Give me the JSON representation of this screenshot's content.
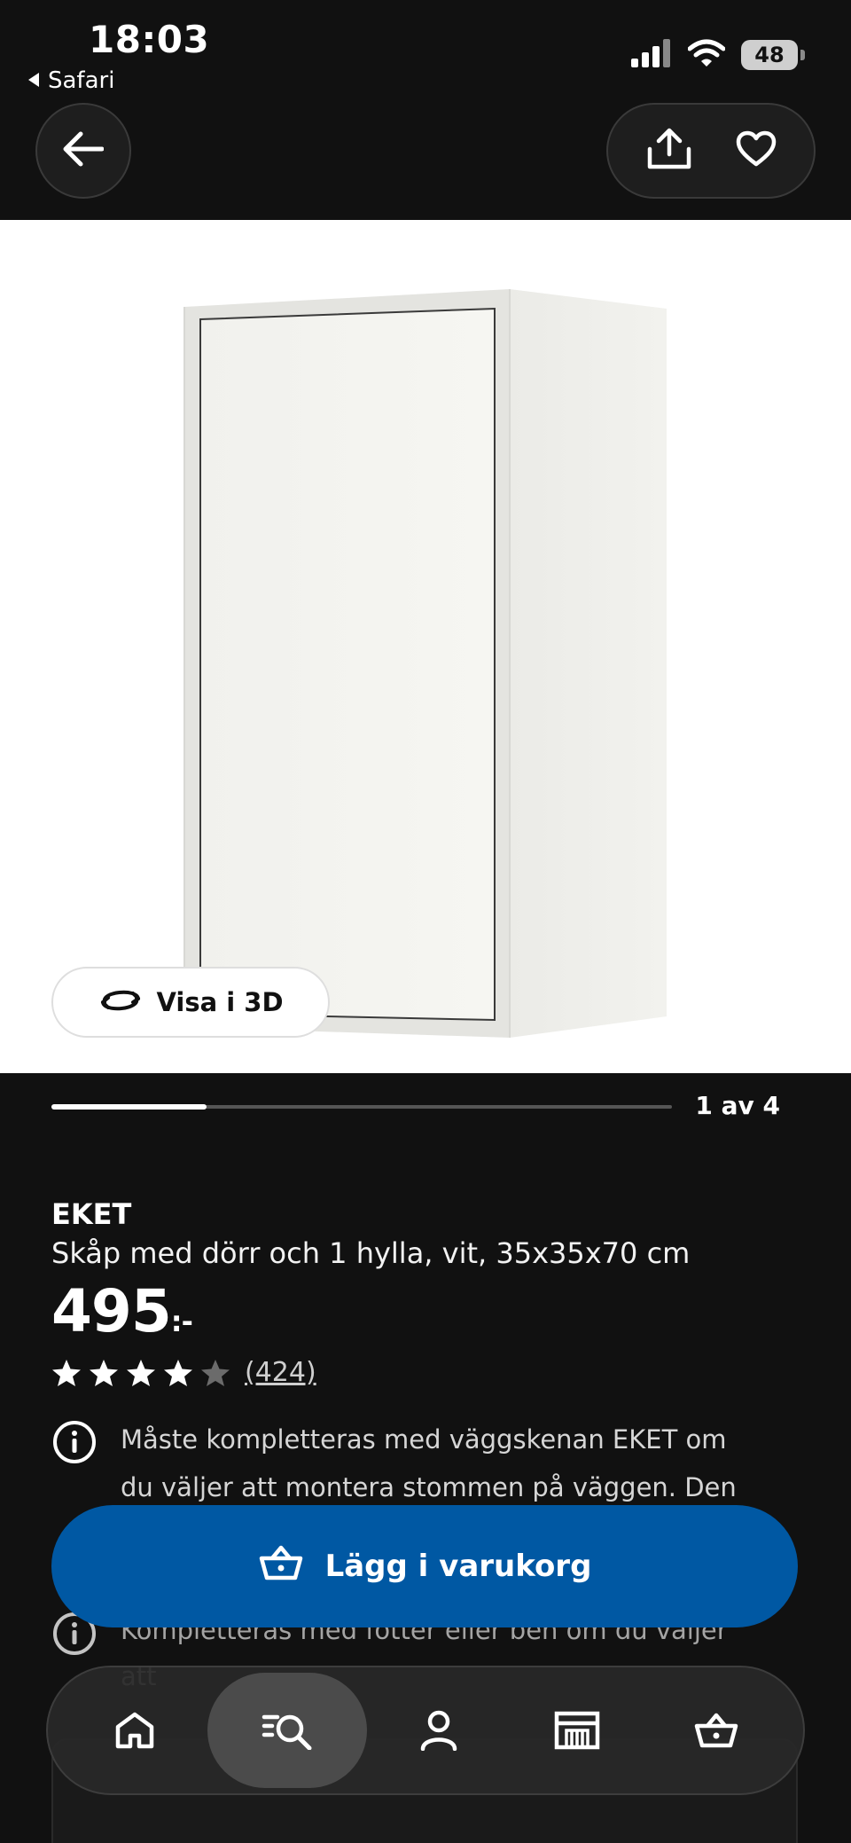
{
  "status_bar": {
    "time": "18:03",
    "back_app": "Safari",
    "battery": "48"
  },
  "product": {
    "brand": "EKET",
    "description": "Skåp med dörr och 1 hylla, vit, 35x35x70 cm",
    "price": "495",
    "price_suffix": ":-",
    "rating": 4,
    "rating_max": 5,
    "review_count": "(424)"
  },
  "gallery": {
    "view_3d_label": "Visa i 3D",
    "indicator_text": "1 av 4",
    "current": 1,
    "total": 4
  },
  "notes": [
    {
      "text": "Måste kompletteras med väggskenan EKET om du väljer att montera stommen på väggen. Den här"
    },
    {
      "text": "Kompletteras med fötter eller ben om du väljer att"
    }
  ],
  "cart": {
    "add_label": "Lägg i varukorg"
  },
  "tabs": [
    {
      "name": "home",
      "icon": "home-icon",
      "active": false
    },
    {
      "name": "search",
      "icon": "search-list-icon",
      "active": true
    },
    {
      "name": "profile",
      "icon": "user-icon",
      "active": false
    },
    {
      "name": "stores",
      "icon": "store-icon",
      "active": false
    },
    {
      "name": "cart",
      "icon": "basket-icon",
      "active": false
    }
  ],
  "colors": {
    "background": "#111111",
    "primary_button": "#0058a3",
    "text": "#ffffff"
  }
}
